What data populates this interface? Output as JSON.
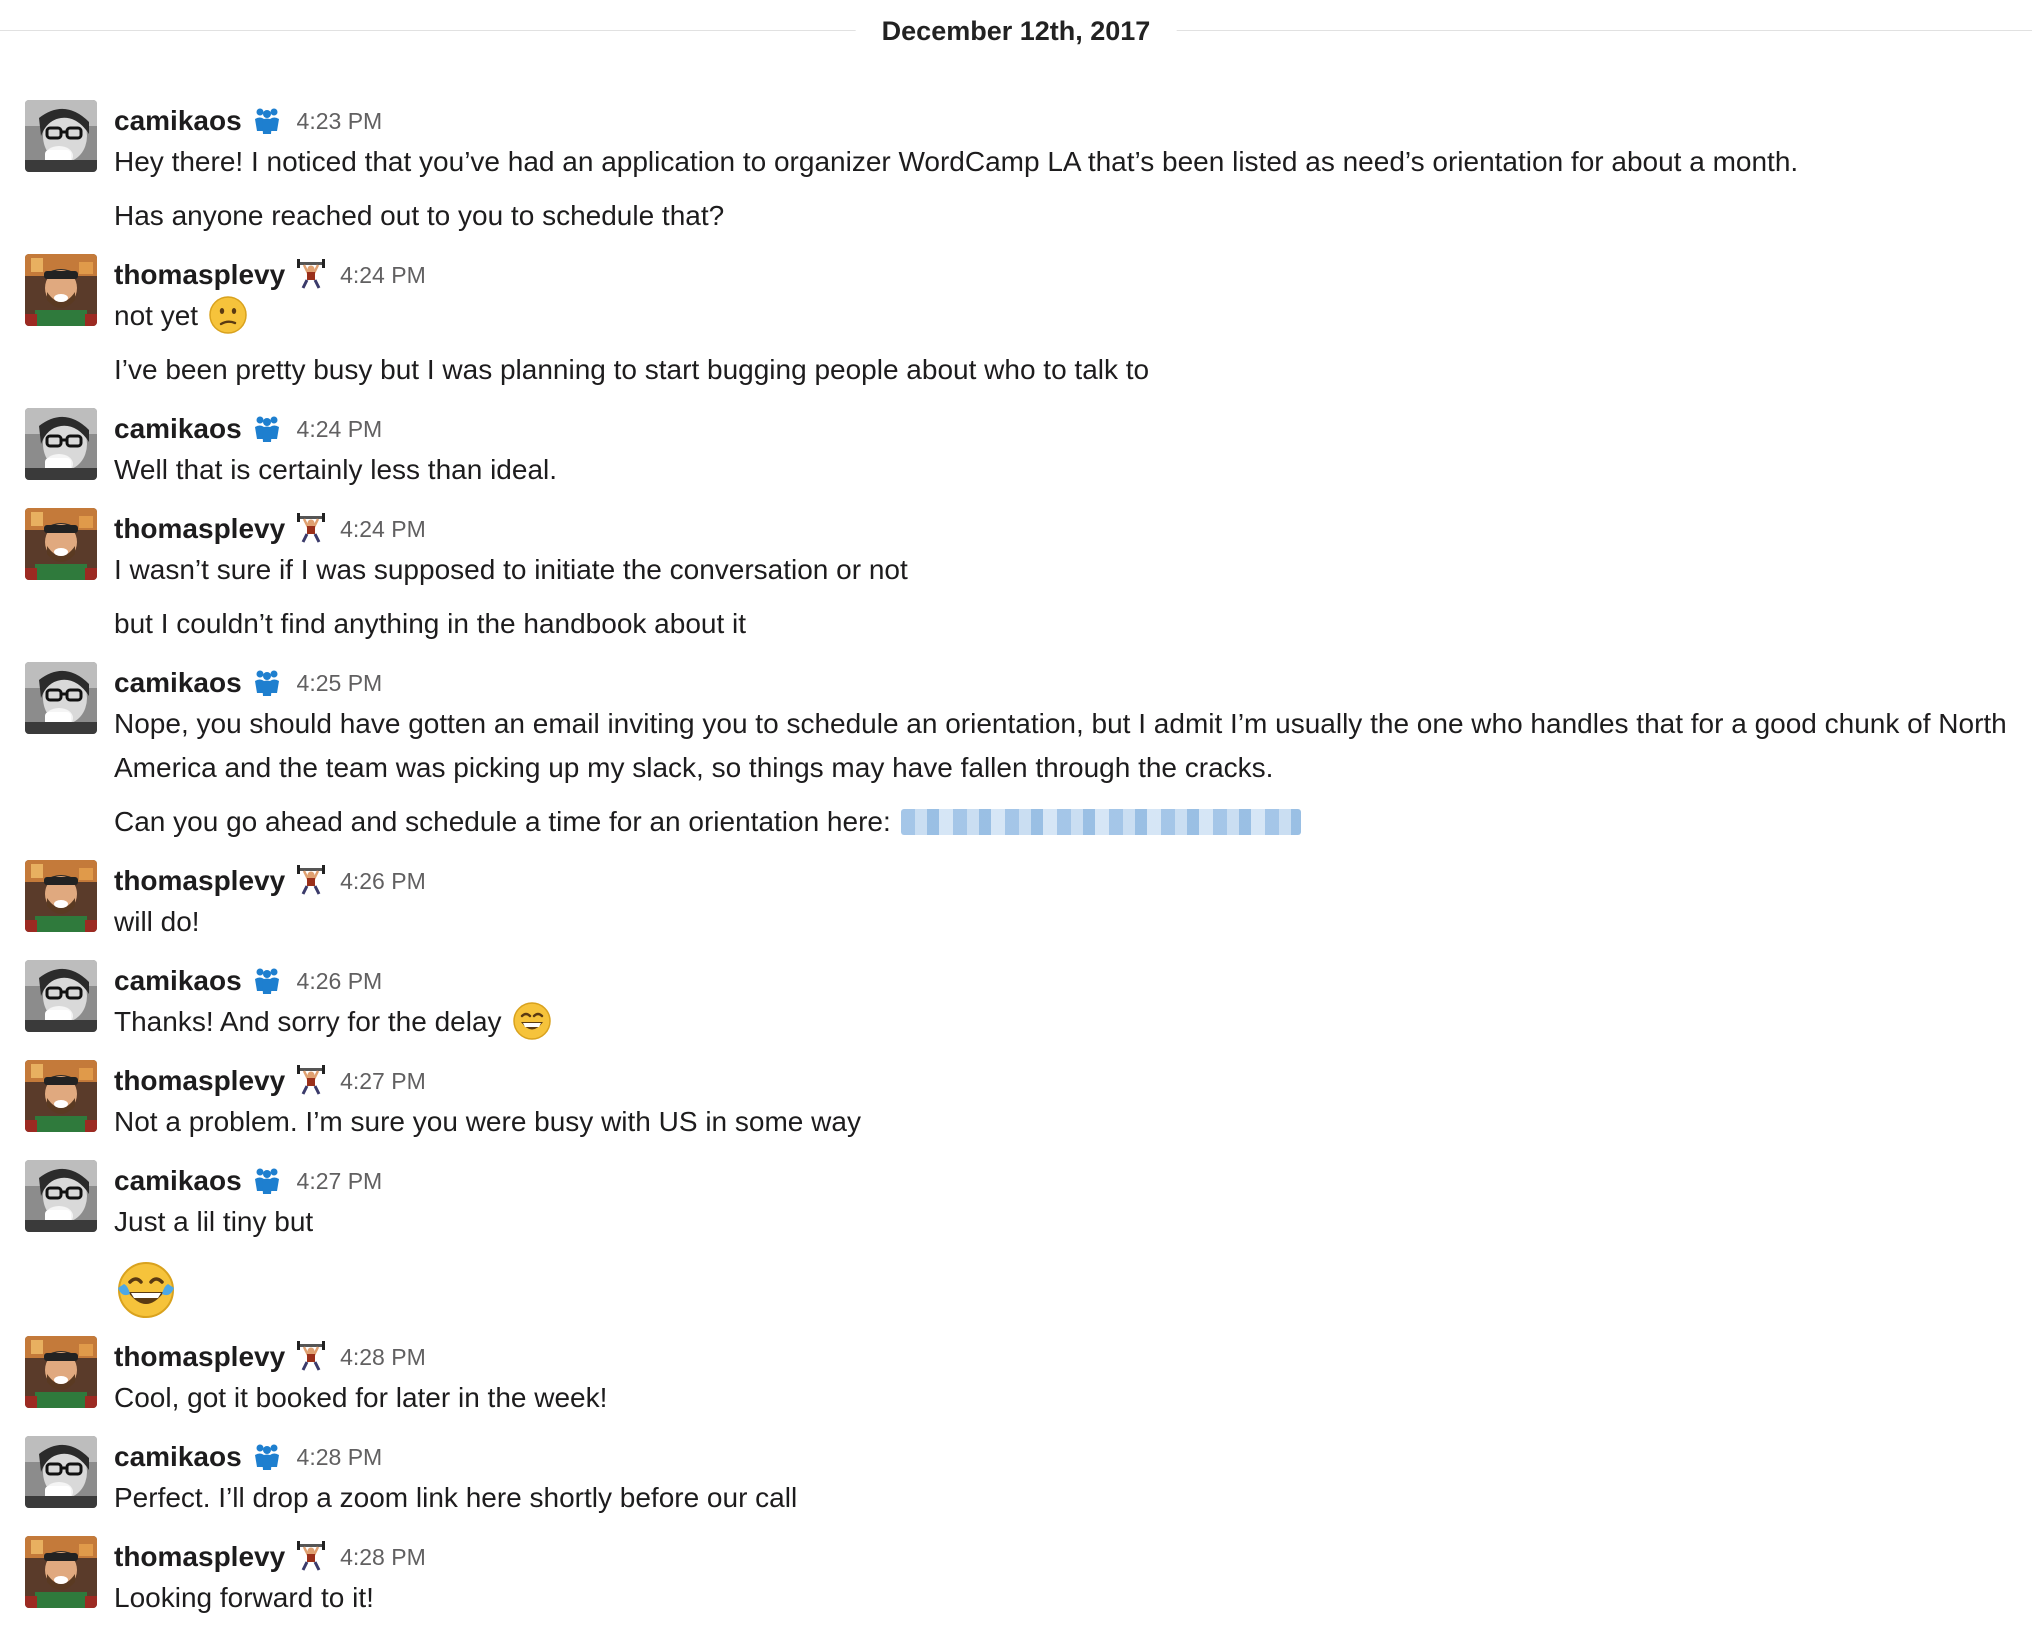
{
  "date_divider": "December 12th, 2017",
  "colors": {
    "camikaos_badge": "#1e7fcf",
    "thomasplevy_badge": "#9a2f1a",
    "link_blur": "#7aaedc",
    "emoji_yellow": "#f6c33b"
  },
  "users": {
    "camikaos": {
      "name": "camikaos",
      "status_icon": "people-group-icon"
    },
    "thomasplevy": {
      "name": "thomasplevy",
      "status_icon": "weightlifter-icon"
    }
  },
  "messages": [
    {
      "user": "camikaos",
      "time": "4:23 PM",
      "lines": [
        "Hey there! I noticed that you’ve had an application to organizer WordCamp LA that’s been listed as need’s orientation for about a month.",
        "Has anyone reached out to you to schedule that?"
      ]
    },
    {
      "user": "thomasplevy",
      "time": "4:24 PM",
      "lines": [
        "not yet",
        "I’ve been pretty busy but I was planning to start bugging people about who to talk to"
      ],
      "line_emoji": "confused-face-emoji"
    },
    {
      "user": "camikaos",
      "time": "4:24 PM",
      "lines": [
        "Well that is certainly less than ideal."
      ]
    },
    {
      "user": "thomasplevy",
      "time": "4:24 PM",
      "lines": [
        "I wasn’t sure if I was supposed to initiate the conversation or not",
        "but I couldn’t find anything in the handbook about it"
      ]
    },
    {
      "user": "camikaos",
      "time": "4:25 PM",
      "lines": [
        "Nope, you should have gotten an email inviting you to schedule an orientation, but I admit I’m usually the one who handles that for a good chunk of North America and the team was picking up my slack, so things may have fallen through the cracks.",
        "Can you go ahead and schedule a time for an orientation here:"
      ]
    },
    {
      "user": "thomasplevy",
      "time": "4:26 PM",
      "lines": [
        "will do!"
      ]
    },
    {
      "user": "camikaos",
      "time": "4:26 PM",
      "lines": [
        "Thanks! And sorry for the delay"
      ],
      "line_emoji": "grinning-face-emoji"
    },
    {
      "user": "thomasplevy",
      "time": "4:27 PM",
      "lines": [
        "Not a problem. I’m sure you were busy with US in some way"
      ]
    },
    {
      "user": "camikaos",
      "time": "4:27 PM",
      "lines": [
        "Just a lil tiny but"
      ],
      "extra_emoji": "tears-of-joy-emoji"
    },
    {
      "user": "thomasplevy",
      "time": "4:28 PM",
      "lines": [
        "Cool, got it booked for later in the week!"
      ]
    },
    {
      "user": "camikaos",
      "time": "4:28 PM",
      "lines": [
        "Perfect. I’ll drop a zoom link here shortly before our call"
      ]
    },
    {
      "user": "thomasplevy",
      "time": "4:28 PM",
      "lines": [
        "Looking forward to it!"
      ]
    }
  ]
}
